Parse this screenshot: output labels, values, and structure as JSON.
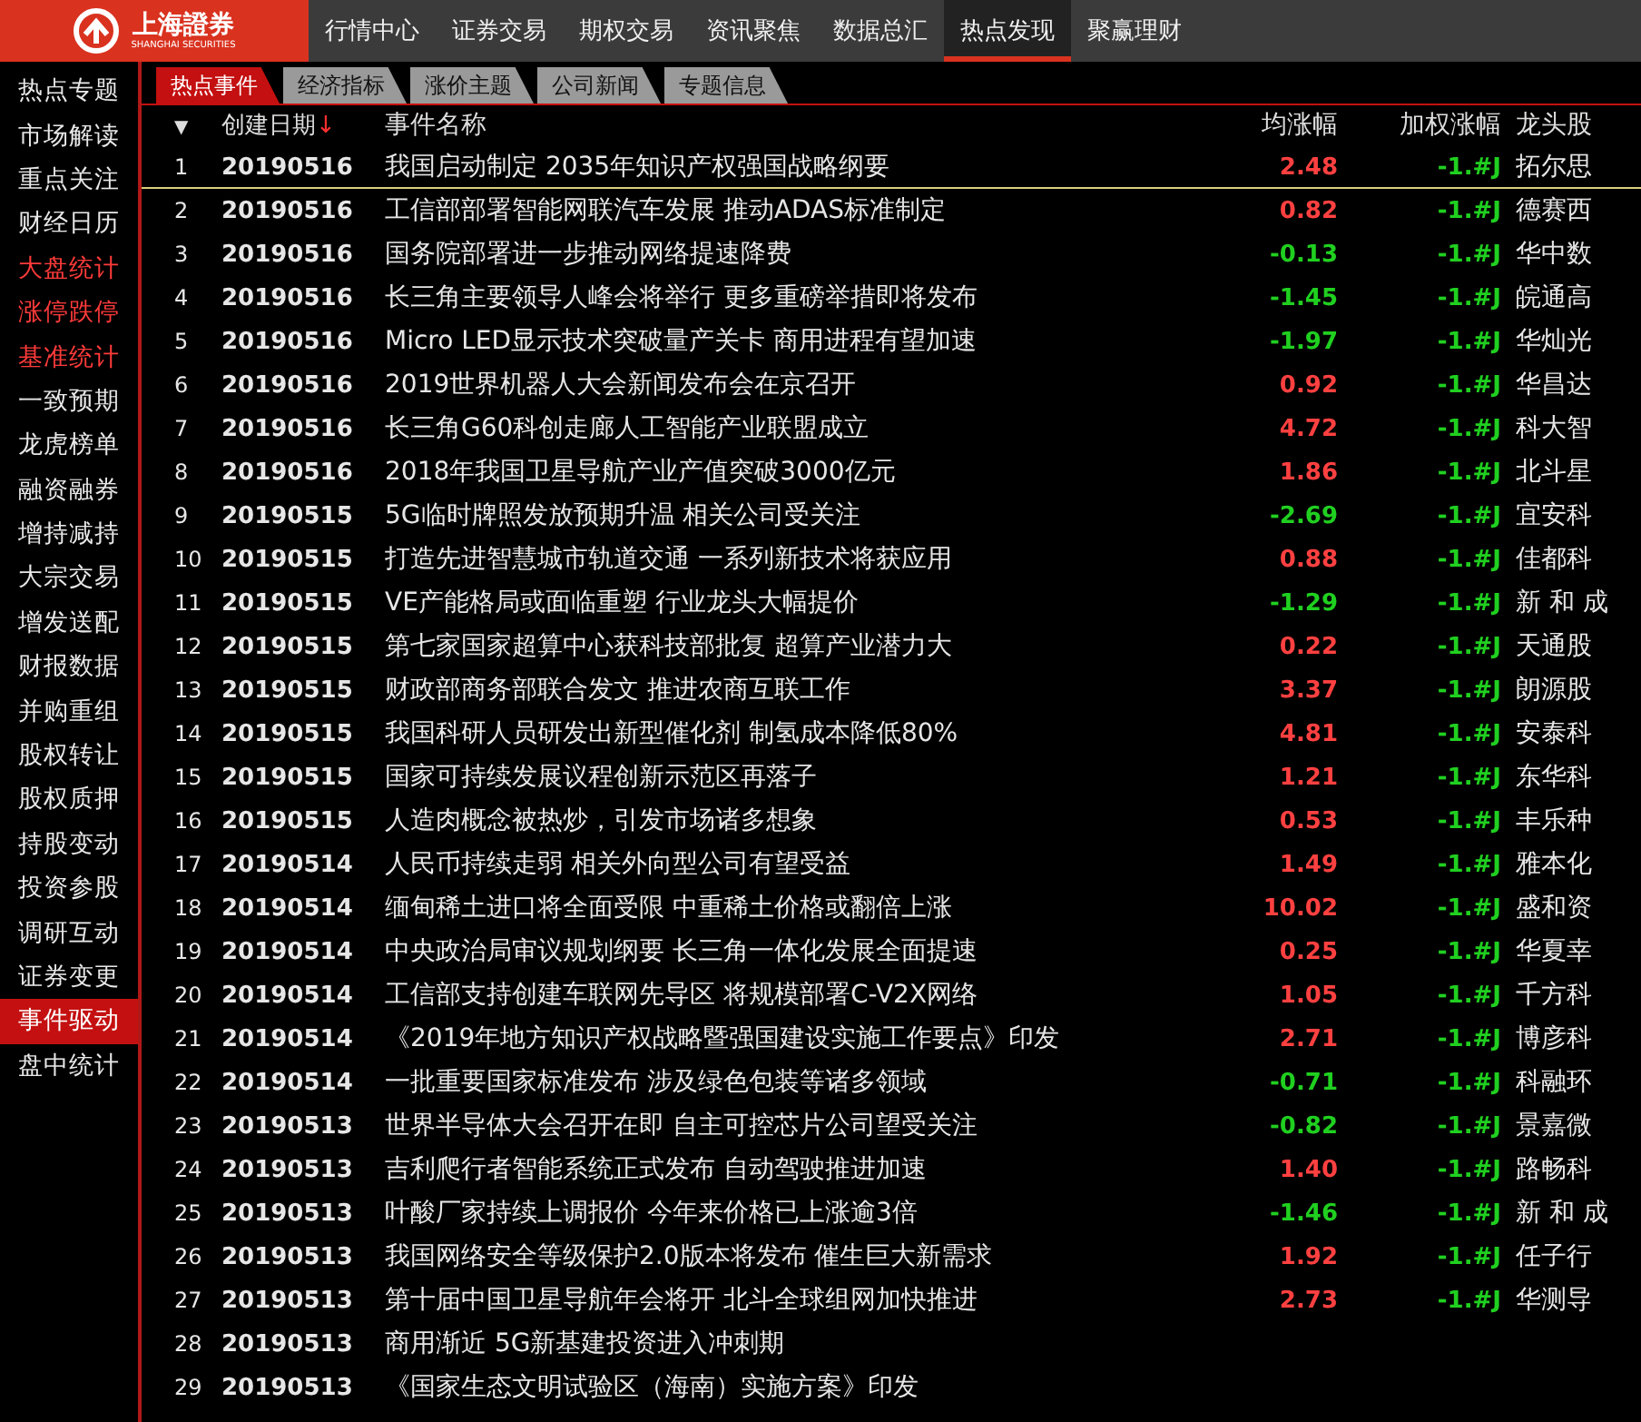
{
  "logo": {
    "name": "上海證券",
    "subtitle": "SHANGHAI SECURITIES"
  },
  "nav": [
    {
      "label": "行情中心",
      "selected": false
    },
    {
      "label": "证券交易",
      "selected": false
    },
    {
      "label": "期权交易",
      "selected": false
    },
    {
      "label": "资讯聚焦",
      "selected": false
    },
    {
      "label": "数据总汇",
      "selected": false
    },
    {
      "label": "热点发现",
      "selected": true
    },
    {
      "label": "聚赢理财",
      "selected": false
    }
  ],
  "sidebar": {
    "items": [
      {
        "label": "热点专题",
        "highlighted": false,
        "selected": false
      },
      {
        "label": "市场解读",
        "highlighted": false,
        "selected": false
      },
      {
        "label": "重点关注",
        "highlighted": false,
        "selected": false
      },
      {
        "label": "财经日历",
        "highlighted": false,
        "selected": false
      },
      {
        "label": "大盘统计",
        "highlighted": true,
        "selected": false
      },
      {
        "label": "涨停跌停",
        "highlighted": true,
        "selected": false
      },
      {
        "label": "基准统计",
        "highlighted": true,
        "selected": false
      },
      {
        "label": "一致预期",
        "highlighted": false,
        "selected": false
      },
      {
        "label": "龙虎榜单",
        "highlighted": false,
        "selected": false
      },
      {
        "label": "融资融券",
        "highlighted": false,
        "selected": false
      },
      {
        "label": "增持减持",
        "highlighted": false,
        "selected": false
      },
      {
        "label": "大宗交易",
        "highlighted": false,
        "selected": false
      },
      {
        "label": "增发送配",
        "highlighted": false,
        "selected": false
      },
      {
        "label": "财报数据",
        "highlighted": false,
        "selected": false
      },
      {
        "label": "并购重组",
        "highlighted": false,
        "selected": false
      },
      {
        "label": "股权转让",
        "highlighted": false,
        "selected": false
      },
      {
        "label": "股权质押",
        "highlighted": false,
        "selected": false
      },
      {
        "label": "持股变动",
        "highlighted": false,
        "selected": false
      },
      {
        "label": "投资参股",
        "highlighted": false,
        "selected": false
      },
      {
        "label": "调研互动",
        "highlighted": false,
        "selected": false
      },
      {
        "label": "证券变更",
        "highlighted": false,
        "selected": false
      },
      {
        "label": "事件驱动",
        "highlighted": false,
        "selected": true
      },
      {
        "label": "盘中统计",
        "highlighted": false,
        "selected": false
      }
    ]
  },
  "tabs": [
    {
      "label": "热点事件",
      "selected": true
    },
    {
      "label": "经济指标",
      "selected": false
    },
    {
      "label": "涨价主题",
      "selected": false
    },
    {
      "label": "公司新闻",
      "selected": false
    },
    {
      "label": "专题信息",
      "selected": false
    }
  ],
  "table": {
    "menu_glyph": "▼",
    "columns": [
      {
        "label": "创建日期",
        "sort_glyph": "↓"
      },
      {
        "label": "事件名称"
      },
      {
        "label": "均涨幅"
      },
      {
        "label": "加权涨幅"
      },
      {
        "label": "龙头股"
      }
    ],
    "rows": [
      {
        "index": "1",
        "date": "20190516",
        "name": "我国启动制定 2035年知识产权强国战略纲要",
        "avg": "2.48",
        "rising": true,
        "weighted": "-1.#J",
        "leader": "拓尔思",
        "selected": true
      },
      {
        "index": "2",
        "date": "20190516",
        "name": "工信部部署智能网联汽车发展 推动ADAS标准制定",
        "avg": "0.82",
        "rising": true,
        "weighted": "-1.#J",
        "leader": "德赛西",
        "selected": false
      },
      {
        "index": "3",
        "date": "20190516",
        "name": "国务院部署进一步推动网络提速降费",
        "avg": "-0.13",
        "rising": false,
        "weighted": "-1.#J",
        "leader": "华中数",
        "selected": false
      },
      {
        "index": "4",
        "date": "20190516",
        "name": "长三角主要领导人峰会将举行 更多重磅举措即将发布",
        "avg": "-1.45",
        "rising": false,
        "weighted": "-1.#J",
        "leader": "皖通高",
        "selected": false
      },
      {
        "index": "5",
        "date": "20190516",
        "name": "Micro LED显示技术突破量产关卡 商用进程有望加速",
        "avg": "-1.97",
        "rising": false,
        "weighted": "-1.#J",
        "leader": "华灿光",
        "selected": false
      },
      {
        "index": "6",
        "date": "20190516",
        "name": "2019世界机器人大会新闻发布会在京召开",
        "avg": "0.92",
        "rising": true,
        "weighted": "-1.#J",
        "leader": "华昌达",
        "selected": false
      },
      {
        "index": "7",
        "date": "20190516",
        "name": "长三角G60科创走廊人工智能产业联盟成立",
        "avg": "4.72",
        "rising": true,
        "weighted": "-1.#J",
        "leader": "科大智",
        "selected": false
      },
      {
        "index": "8",
        "date": "20190516",
        "name": "2018年我国卫星导航产业产值突破3000亿元",
        "avg": "1.86",
        "rising": true,
        "weighted": "-1.#J",
        "leader": "北斗星",
        "selected": false
      },
      {
        "index": "9",
        "date": "20190515",
        "name": "5G临时牌照发放预期升温 相关公司受关注",
        "avg": "-2.69",
        "rising": false,
        "weighted": "-1.#J",
        "leader": "宜安科",
        "selected": false
      },
      {
        "index": "10",
        "date": "20190515",
        "name": "打造先进智慧城市轨道交通 一系列新技术将获应用",
        "avg": "0.88",
        "rising": true,
        "weighted": "-1.#J",
        "leader": "佳都科",
        "selected": false
      },
      {
        "index": "11",
        "date": "20190515",
        "name": "VE产能格局或面临重塑 行业龙头大幅提价",
        "avg": "-1.29",
        "rising": false,
        "weighted": "-1.#J",
        "leader": "新 和 成",
        "selected": false
      },
      {
        "index": "12",
        "date": "20190515",
        "name": "第七家国家超算中心获科技部批复 超算产业潜力大",
        "avg": "0.22",
        "rising": true,
        "weighted": "-1.#J",
        "leader": "天通股",
        "selected": false
      },
      {
        "index": "13",
        "date": "20190515",
        "name": "财政部商务部联合发文 推进农商互联工作",
        "avg": "3.37",
        "rising": true,
        "weighted": "-1.#J",
        "leader": "朗源股",
        "selected": false
      },
      {
        "index": "14",
        "date": "20190515",
        "name": "我国科研人员研发出新型催化剂 制氢成本降低80%",
        "avg": "4.81",
        "rising": true,
        "weighted": "-1.#J",
        "leader": "安泰科",
        "selected": false
      },
      {
        "index": "15",
        "date": "20190515",
        "name": "国家可持续发展议程创新示范区再落子",
        "avg": "1.21",
        "rising": true,
        "weighted": "-1.#J",
        "leader": "东华科",
        "selected": false
      },
      {
        "index": "16",
        "date": "20190515",
        "name": "人造肉概念被热炒，引发市场诸多想象",
        "avg": "0.53",
        "rising": true,
        "weighted": "-1.#J",
        "leader": "丰乐种",
        "selected": false
      },
      {
        "index": "17",
        "date": "20190514",
        "name": "人民币持续走弱 相关外向型公司有望受益",
        "avg": "1.49",
        "rising": true,
        "weighted": "-1.#J",
        "leader": "雅本化",
        "selected": false
      },
      {
        "index": "18",
        "date": "20190514",
        "name": "缅甸稀土进口将全面受限 中重稀土价格或翻倍上涨",
        "avg": "10.02",
        "rising": true,
        "weighted": "-1.#J",
        "leader": "盛和资",
        "selected": false
      },
      {
        "index": "19",
        "date": "20190514",
        "name": "中央政治局审议规划纲要 长三角一体化发展全面提速",
        "avg": "0.25",
        "rising": true,
        "weighted": "-1.#J",
        "leader": "华夏幸",
        "selected": false
      },
      {
        "index": "20",
        "date": "20190514",
        "name": "工信部支持创建车联网先导区 将规模部署C-V2X网络",
        "avg": "1.05",
        "rising": true,
        "weighted": "-1.#J",
        "leader": "千方科",
        "selected": false
      },
      {
        "index": "21",
        "date": "20190514",
        "name": "《2019年地方知识产权战略暨强国建设实施工作要点》印发",
        "avg": "2.71",
        "rising": true,
        "weighted": "-1.#J",
        "leader": "博彦科",
        "selected": false
      },
      {
        "index": "22",
        "date": "20190514",
        "name": "一批重要国家标准发布 涉及绿色包装等诸多领域",
        "avg": "-0.71",
        "rising": false,
        "weighted": "-1.#J",
        "leader": "科融环",
        "selected": false
      },
      {
        "index": "23",
        "date": "20190513",
        "name": "世界半导体大会召开在即 自主可控芯片公司望受关注",
        "avg": "-0.82",
        "rising": false,
        "weighted": "-1.#J",
        "leader": "景嘉微",
        "selected": false
      },
      {
        "index": "24",
        "date": "20190513",
        "name": "吉利爬行者智能系统正式发布 自动驾驶推进加速",
        "avg": "1.40",
        "rising": true,
        "weighted": "-1.#J",
        "leader": "路畅科",
        "selected": false
      },
      {
        "index": "25",
        "date": "20190513",
        "name": "叶酸厂家持续上调报价 今年来价格已上涨逾3倍",
        "avg": "-1.46",
        "rising": false,
        "weighted": "-1.#J",
        "leader": "新 和 成",
        "selected": false
      },
      {
        "index": "26",
        "date": "20190513",
        "name": "我国网络安全等级保护2.0版本将发布 催生巨大新需求",
        "avg": "1.92",
        "rising": true,
        "weighted": "-1.#J",
        "leader": "任子行",
        "selected": false
      },
      {
        "index": "27",
        "date": "20190513",
        "name": "第十届中国卫星导航年会将开 北斗全球组网加快推进",
        "avg": "2.73",
        "rising": true,
        "weighted": "-1.#J",
        "leader": "华测导",
        "selected": false
      },
      {
        "index": "28",
        "date": "20190513",
        "name": "商用渐近 5G新基建投资进入冲刺期",
        "selected": false
      },
      {
        "index": "29",
        "date": "20190513",
        "name": "《国家生态文明试验区（海南）实施方案》印发",
        "selected": false
      }
    ]
  }
}
